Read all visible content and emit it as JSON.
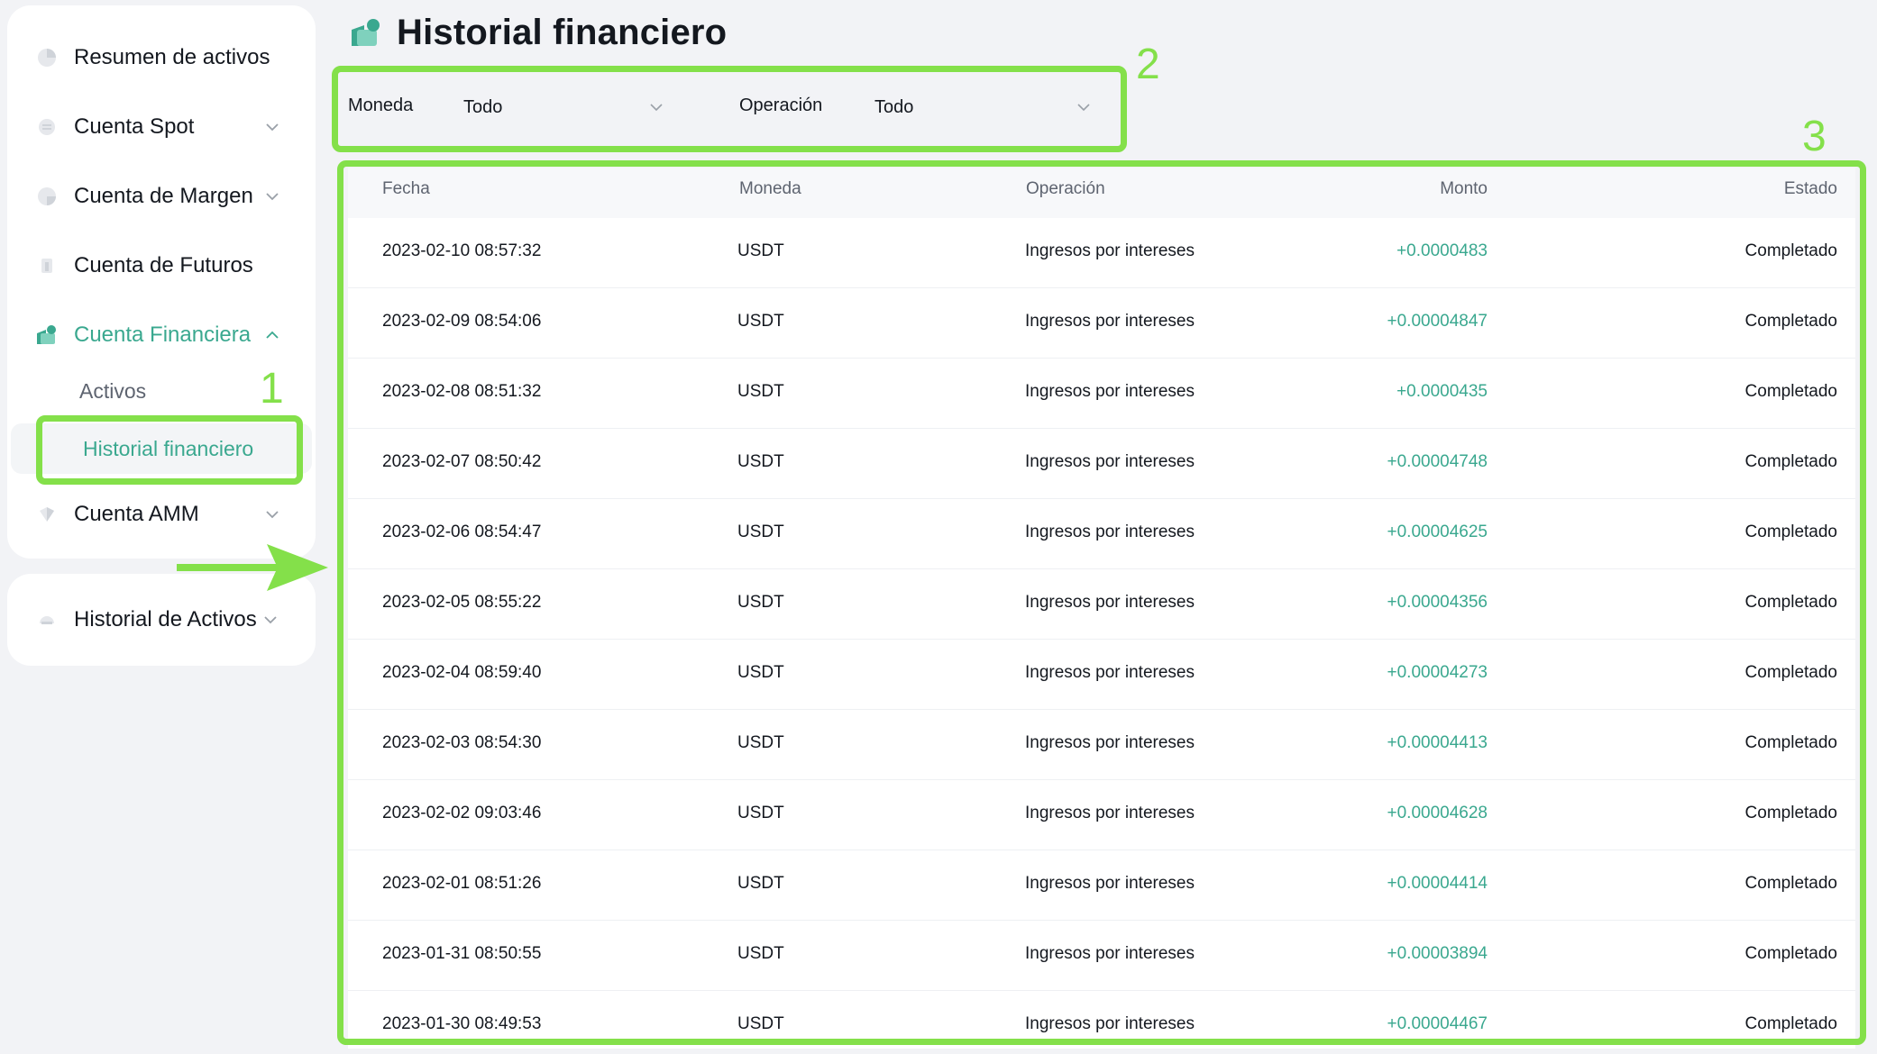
{
  "colors": {
    "accent": "#3aa88f",
    "highlight": "#84e04a"
  },
  "sidebar": {
    "items": [
      {
        "label": "Resumen de activos",
        "icon": "pie-chart-icon"
      },
      {
        "label": "Cuenta Spot",
        "icon": "spot-wallet-icon"
      },
      {
        "label": "Cuenta de Margen",
        "icon": "margin-icon"
      },
      {
        "label": "Cuenta de Futuros",
        "icon": "futures-icon"
      },
      {
        "label": "Cuenta Financiera",
        "icon": "finance-wallet-icon"
      },
      {
        "label": "Cuenta AMM",
        "icon": "amm-icon"
      }
    ],
    "sub_items": [
      {
        "label": "Activos"
      },
      {
        "label": "Historial financiero"
      }
    ],
    "secondary": {
      "label": "Historial de Activos",
      "icon": "history-icon"
    }
  },
  "header": {
    "title": "Historial financiero",
    "icon": "finance-wallet-icon"
  },
  "filters": {
    "currency": {
      "label": "Moneda",
      "value": "Todo"
    },
    "operation": {
      "label": "Operación",
      "value": "Todo"
    }
  },
  "table": {
    "columns": [
      "Fecha",
      "Moneda",
      "Operación",
      "Monto",
      "Estado"
    ],
    "rows": [
      {
        "date": "2023-02-10 08:57:32",
        "currency": "USDT",
        "operation": "Ingresos por intereses",
        "amount": "+0.0000483",
        "status": "Completado"
      },
      {
        "date": "2023-02-09 08:54:06",
        "currency": "USDT",
        "operation": "Ingresos por intereses",
        "amount": "+0.00004847",
        "status": "Completado"
      },
      {
        "date": "2023-02-08 08:51:32",
        "currency": "USDT",
        "operation": "Ingresos por intereses",
        "amount": "+0.0000435",
        "status": "Completado"
      },
      {
        "date": "2023-02-07 08:50:42",
        "currency": "USDT",
        "operation": "Ingresos por intereses",
        "amount": "+0.00004748",
        "status": "Completado"
      },
      {
        "date": "2023-02-06 08:54:47",
        "currency": "USDT",
        "operation": "Ingresos por intereses",
        "amount": "+0.00004625",
        "status": "Completado"
      },
      {
        "date": "2023-02-05 08:55:22",
        "currency": "USDT",
        "operation": "Ingresos por intereses",
        "amount": "+0.00004356",
        "status": "Completado"
      },
      {
        "date": "2023-02-04 08:59:40",
        "currency": "USDT",
        "operation": "Ingresos por intereses",
        "amount": "+0.00004273",
        "status": "Completado"
      },
      {
        "date": "2023-02-03 08:54:30",
        "currency": "USDT",
        "operation": "Ingresos por intereses",
        "amount": "+0.00004413",
        "status": "Completado"
      },
      {
        "date": "2023-02-02 09:03:46",
        "currency": "USDT",
        "operation": "Ingresos por intereses",
        "amount": "+0.00004628",
        "status": "Completado"
      },
      {
        "date": "2023-02-01 08:51:26",
        "currency": "USDT",
        "operation": "Ingresos por intereses",
        "amount": "+0.00004414",
        "status": "Completado"
      },
      {
        "date": "2023-01-31 08:50:55",
        "currency": "USDT",
        "operation": "Ingresos por intereses",
        "amount": "+0.00003894",
        "status": "Completado"
      },
      {
        "date": "2023-01-30 08:49:53",
        "currency": "USDT",
        "operation": "Ingresos por intereses",
        "amount": "+0.00004467",
        "status": "Completado"
      }
    ]
  },
  "annotations": {
    "labels": [
      "1",
      "2",
      "3"
    ]
  }
}
